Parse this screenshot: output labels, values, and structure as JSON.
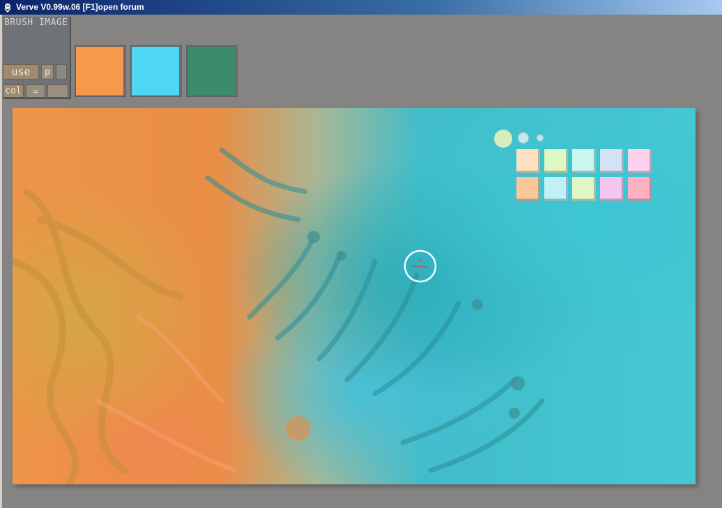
{
  "window": {
    "title": "Verve V0.99w.06 [F1]open forum",
    "icon": "verve-app-icon"
  },
  "brush_panel": {
    "label": "BRUSH  IMAGE",
    "use_label": "use",
    "p_label": "p",
    "col_label": "col",
    "eq_label": "="
  },
  "swatches": [
    {
      "name": "orange",
      "color": "#f5994d"
    },
    {
      "name": "cyan",
      "color": "#4ed6f2"
    },
    {
      "name": "green",
      "color": "#3c8c6c"
    }
  ],
  "palette": [
    "#fde2c2",
    "#ddf8c2",
    "#c9f6ef",
    "#d4e2f6",
    "#fcd2ef",
    "#f8c89a",
    "#c3f0f7",
    "#e0f6c4",
    "#f2c6ee",
    "#fcb0c0"
  ],
  "colors": {
    "titlebar_start": "#0a246a",
    "background": "#858482"
  }
}
